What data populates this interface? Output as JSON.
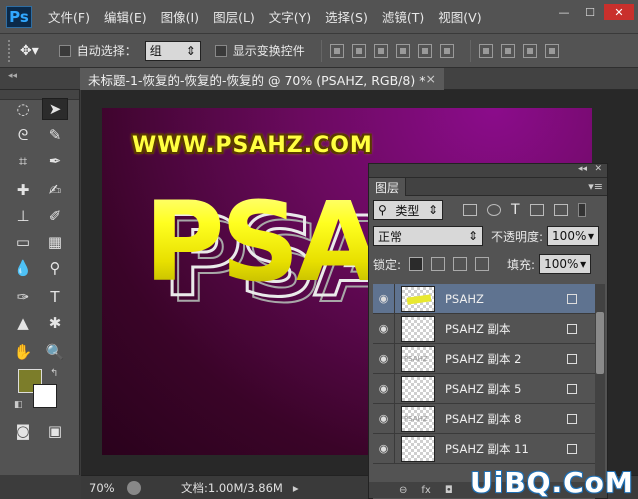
{
  "app": {
    "logo": "Ps",
    "menu": [
      "文件(F)",
      "编辑(E)",
      "图像(I)",
      "图层(L)",
      "文字(Y)",
      "选择(S)",
      "滤镜(T)",
      "视图(V)"
    ],
    "window_controls": {
      "minimize": "—",
      "maximize": "☐",
      "close": "✕"
    }
  },
  "options": {
    "auto_select_label": "自动选择：",
    "auto_select_value": "组",
    "show_transform_label": "显示变换控件"
  },
  "document": {
    "tab_title": "未标题-1-恢复的-恢复的-恢复的 @ 70% (PSAHZ, RGB/8) *",
    "tab_close": "×"
  },
  "canvas": {
    "title_text": "WWW.PSAHZ.COM",
    "big_text": "PSAHZ"
  },
  "status": {
    "zoom": "70%",
    "doc_info": "文档:1.00M/3.86M"
  },
  "layers": {
    "tab_label": "图层",
    "filter_kind": "类型",
    "blend_mode": "正常",
    "opacity_label": "不透明度:",
    "opacity_value": "100%",
    "lock_label": "锁定:",
    "fill_label": "填充:",
    "fill_value": "100%",
    "items": [
      {
        "name": "PSAHZ",
        "selected": true
      },
      {
        "name": "PSAHZ 副本",
        "selected": false
      },
      {
        "name": "PSAHZ 副本 2",
        "selected": false
      },
      {
        "name": "PSAHZ 副本 5",
        "selected": false
      },
      {
        "name": "PSAHZ 副本 8",
        "selected": false
      },
      {
        "name": "PSAHZ 副本 11",
        "selected": false
      }
    ],
    "footer": [
      "⊖",
      "fx",
      "◘"
    ]
  },
  "colors": {
    "foreground": "#7c7d2a",
    "background": "#ffffff",
    "selected_layer": "#5f7390"
  },
  "watermark": "UiBQ.CoM"
}
